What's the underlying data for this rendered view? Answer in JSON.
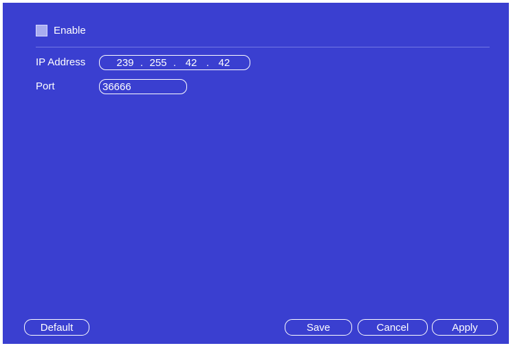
{
  "enable": {
    "label": "Enable",
    "checked": false
  },
  "ip_address": {
    "label": "IP Address",
    "octets": [
      "239",
      "255",
      "42",
      "42"
    ],
    "separator": "."
  },
  "port": {
    "label": "Port",
    "value": "36666"
  },
  "buttons": {
    "default": "Default",
    "save": "Save",
    "cancel": "Cancel",
    "apply": "Apply"
  },
  "colors": {
    "panel_background": "#3a3fd0",
    "text": "#ffffff",
    "checkbox_fill": "#a8acf0"
  }
}
